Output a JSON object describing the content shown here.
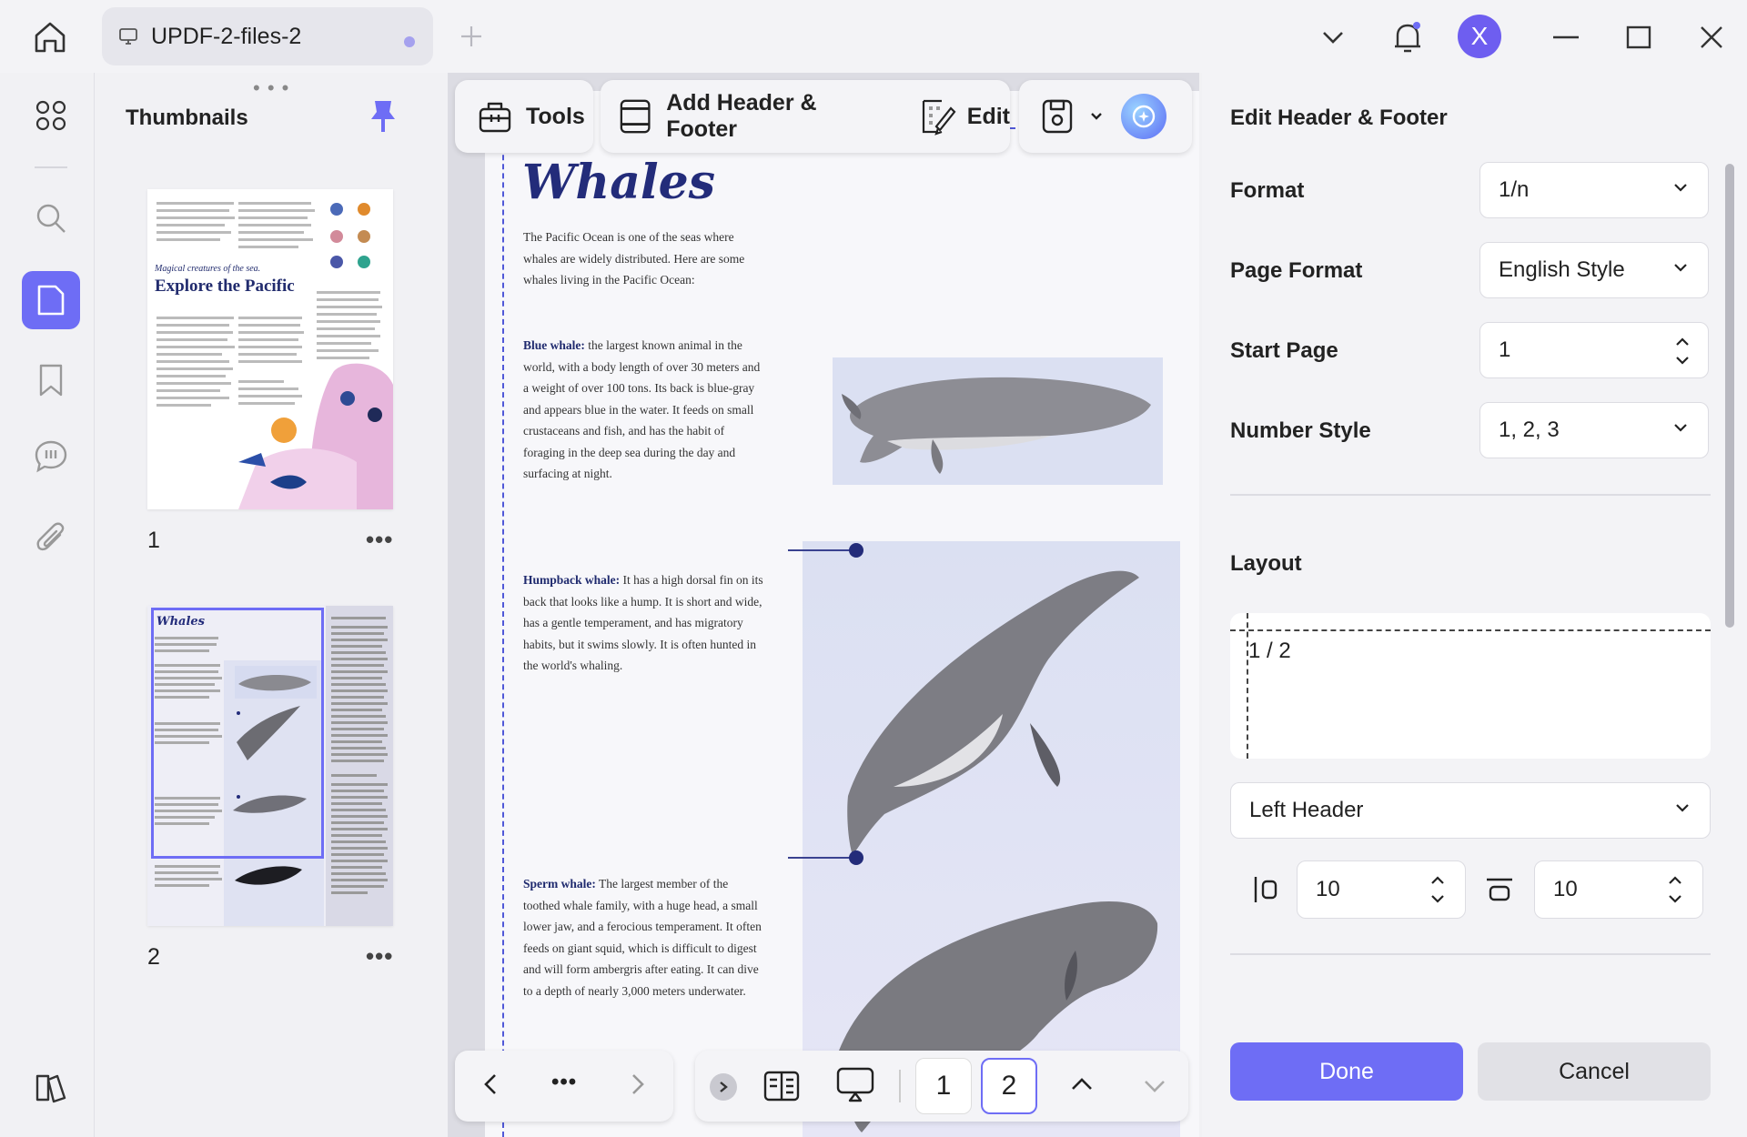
{
  "tab": {
    "title": "UPDF-2-files-2"
  },
  "titlebar": {
    "avatar_letter": "X"
  },
  "thumbnails": {
    "title": "Thumbnails",
    "drag_handle": "• • •",
    "pages": [
      {
        "number": "1",
        "more": "•••",
        "heading_small": "Magical creatures of the sea.",
        "heading": "Explore the Pacific"
      },
      {
        "number": "2",
        "more": "•••",
        "heading": "Whales"
      }
    ]
  },
  "toolbar": {
    "tools_label": "Tools",
    "header_footer_label": "Add Header & Footer",
    "edit_label": "Edit"
  },
  "document": {
    "title": "Whales",
    "intro": "The Pacific Ocean is one of the seas where whales are widely distributed. Here are some whales living in the Pacific Ocean:",
    "blue_whale": {
      "name": "Blue whale:",
      "text": " the largest known animal in the world, with a body length of over 30 meters and a weight of over 100 tons. Its back is blue-gray and appears blue in the water. It feeds on small crustaceans and fish, and has the habit of foraging in the deep sea during the day and surfacing at night."
    },
    "humpback_whale": {
      "name": "Humpback whale:",
      "text": " It has a high dorsal fin on its back that looks like a hump. It is short and wide, has a gentle temperament, and has migratory habits, but it swims slowly. It is often hunted in the world's whaling."
    },
    "sperm_whale": {
      "name": "Sperm whale:",
      "text": " The largest member of the toothed whale family, with a huge head, a small lower jaw, and a ferocious temperament. It often feeds on giant squid, which is difficult to digest and will form ambergris after eating. It can dive to a depth of nearly 3,000 meters underwater."
    }
  },
  "page_nav": {
    "more": "•••",
    "pages": [
      "1",
      "2"
    ],
    "current_page": "2"
  },
  "panel": {
    "title": "Edit Header & Footer",
    "format": {
      "label": "Format",
      "value": "1/n"
    },
    "page_format": {
      "label": "Page Format",
      "value": "English Style"
    },
    "start_page": {
      "label": "Start Page",
      "value": "1"
    },
    "number_style": {
      "label": "Number Style",
      "value": "1, 2, 3"
    },
    "layout": {
      "label": "Layout",
      "preview_text": "1 / 2"
    },
    "position": {
      "value": "Left Header"
    },
    "margin_left": "10",
    "margin_top": "10",
    "done_label": "Done",
    "cancel_label": "Cancel"
  },
  "colors": {
    "accent": "#6e6df5",
    "doc_title": "#232c7a",
    "avatar": "#6e5ef0"
  }
}
